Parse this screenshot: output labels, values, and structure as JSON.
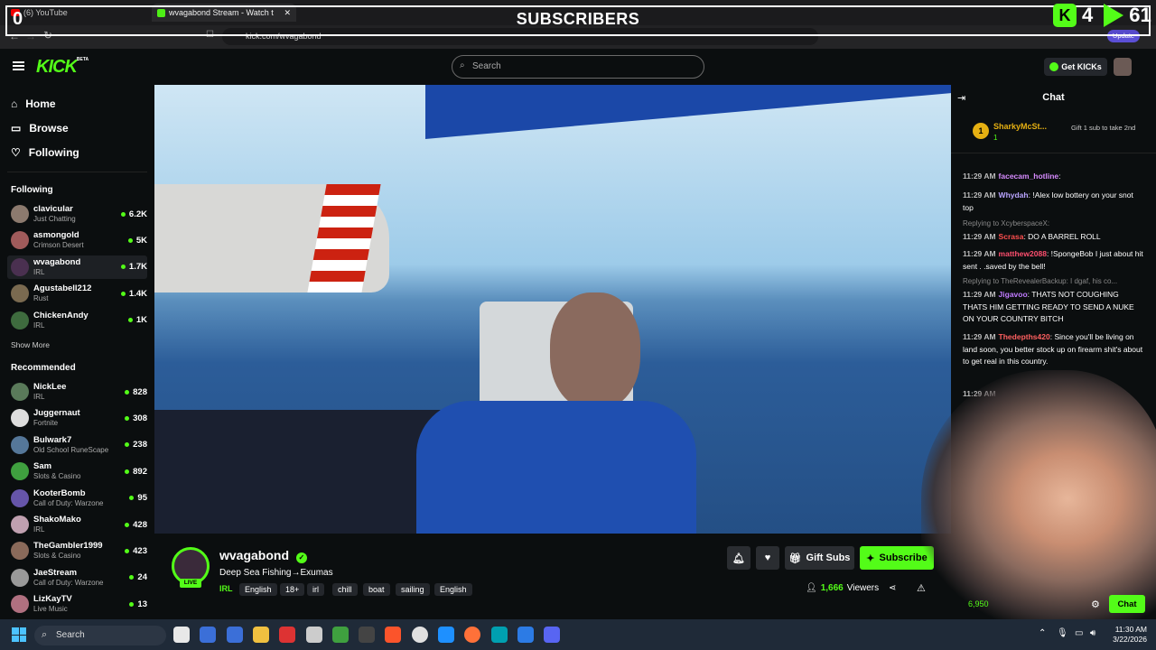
{
  "browser": {
    "tabs": [
      {
        "label": "(6) YouTube"
      },
      {
        "label": "wvagabond Stream - Watch t"
      }
    ],
    "url": "kick.com/wvagabond",
    "update_label": "Update"
  },
  "overlay": {
    "left_count": "0",
    "title": "SUBSCRIBERS",
    "kick_count": "4",
    "right_count": "61"
  },
  "header": {
    "logo": "KICK",
    "logo_badge": "BETA",
    "search_placeholder": "Search",
    "get_kicks": "Get KICKs"
  },
  "sidebar": {
    "nav": [
      {
        "label": "Home"
      },
      {
        "label": "Browse"
      },
      {
        "label": "Following"
      }
    ],
    "following_header": "Following",
    "following": [
      {
        "name": "clavicular",
        "category": "Just Chatting",
        "viewers": "6.2K",
        "color": "#8c7a6e"
      },
      {
        "name": "asmongold",
        "category": "Crimson Desert",
        "viewers": "5K",
        "color": "#a05b5b"
      },
      {
        "name": "wvagabond",
        "category": "IRL",
        "viewers": "1.7K",
        "color": "#4a3050"
      },
      {
        "name": "Agustabell212",
        "category": "Rust",
        "viewers": "1.4K",
        "color": "#7a6a50"
      },
      {
        "name": "ChickenAndy",
        "category": "IRL",
        "viewers": "1K",
        "color": "#3e6b3e"
      }
    ],
    "show_more": "Show More",
    "recommended_header": "Recommended",
    "recommended": [
      {
        "name": "NickLee",
        "category": "IRL",
        "viewers": "828",
        "color": "#5a7a5a"
      },
      {
        "name": "Juggernaut",
        "category": "Fortnite",
        "viewers": "308",
        "color": "#ddd"
      },
      {
        "name": "Bulwark7",
        "category": "Old School RuneScape",
        "viewers": "238",
        "color": "#557799"
      },
      {
        "name": "Sam",
        "category": "Slots & Casino",
        "viewers": "892",
        "color": "#3fa03f"
      },
      {
        "name": "KooterBomb",
        "category": "Call of Duty: Warzone",
        "viewers": "95",
        "color": "#6655aa"
      },
      {
        "name": "ShakoMako",
        "category": "IRL",
        "viewers": "428",
        "color": "#c0a0b0"
      },
      {
        "name": "TheGambler1999",
        "category": "Slots & Casino",
        "viewers": "423",
        "color": "#8a6a5a"
      },
      {
        "name": "JaeStream",
        "category": "Call of Duty: Warzone",
        "viewers": "24",
        "color": "#999"
      },
      {
        "name": "LizKayTV",
        "category": "Live Music",
        "viewers": "13",
        "color": "#b07080"
      }
    ]
  },
  "stream": {
    "name": "wvagabond",
    "live": "LIVE",
    "title": "Deep Sea Fishing→Exumas",
    "category": "IRL",
    "tags": [
      "English",
      "18+",
      "irl",
      "chill",
      "boat",
      "sailing",
      "English"
    ],
    "gift_subs": "Gift Subs",
    "subscribe": "Subscribe",
    "viewers_count": "1,666",
    "viewers_label": "Viewers"
  },
  "chat": {
    "title": "Chat",
    "pinned": {
      "rank": "1",
      "user": "SharkyMcSt...",
      "sub_count": "1",
      "gift_text": "Gift 1 sub to take 2nd"
    },
    "messages": [
      {
        "time": "11:29 AM",
        "user": "facecam_hotline",
        "color": "#d78bff",
        "text": ""
      },
      {
        "time": "11:29 AM",
        "user": "Whydah",
        "color": "#b9a4ff",
        "text": "!Alex low bottery on your snot top"
      },
      {
        "reply": "Replying to XcyberspaceX:",
        "time": "11:29 AM",
        "user": "Scrasa",
        "color": "#ff4f4f",
        "text": "DO A BARREL ROLL"
      },
      {
        "time": "11:29 AM",
        "user": "matthew2088",
        "color": "#ff4f6f",
        "text": "!SpongeBob I just about hit sent . .saved by the bell!"
      },
      {
        "reply": "Replying to TheRevealerBackup: I dgaf, his co...",
        "time": "11:29 AM",
        "user": "Jigavoo",
        "color": "#c07bff",
        "text": "THATS NOT COUGHING THATS HIM GETTING READY TO SEND A NUKE ON YOUR COUNTRY BITCH"
      },
      {
        "time": "11:29 AM",
        "user": "Thedepths420",
        "color": "#ff6060",
        "text": "Since you'll be living on land soon, you better stock up on firearm shit's about to get real in this country."
      },
      {
        "time": "11:29 AM",
        "user": "",
        "color": "#ffffff",
        "text": ""
      }
    ],
    "chat_button": "Chat",
    "bottom_count": "6,950"
  },
  "taskbar": {
    "search": "Search",
    "time": "11:30 AM",
    "date": "3/22/2026"
  },
  "colors": {
    "accent": "#53fc18",
    "bg": "#0b0e0f"
  }
}
